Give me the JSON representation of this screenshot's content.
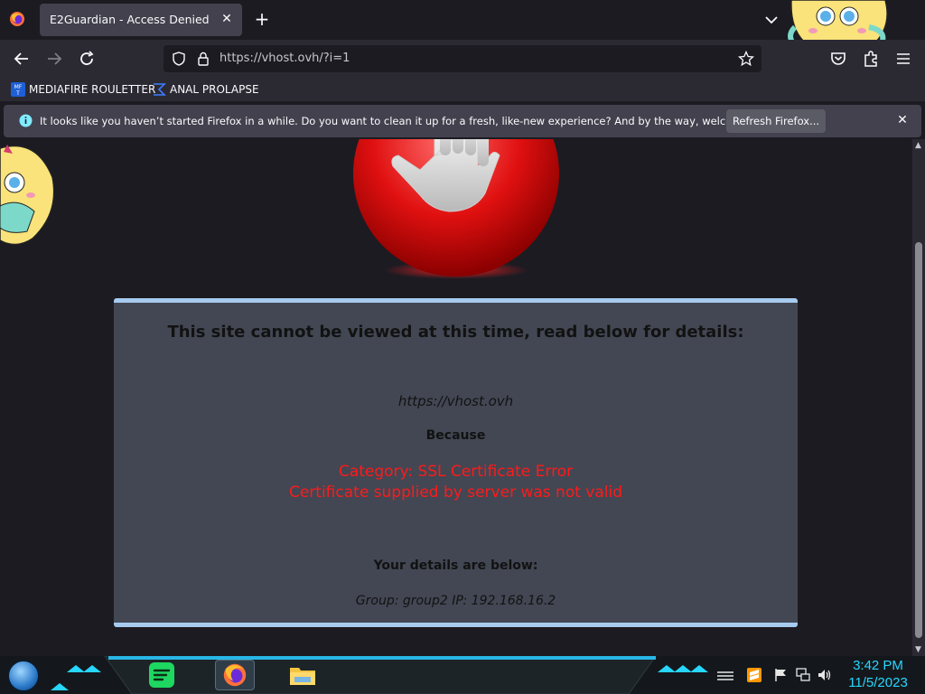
{
  "browser": {
    "tab": {
      "title": "E2Guardian - Access Denied"
    },
    "url": "https://vhost.ovh/?i=1",
    "bookmarks": [
      {
        "label": "MEDIAFIRE ROULETTER",
        "icon": "mediafire-icon"
      },
      {
        "label": "ANAL PROLAPSE",
        "icon": "sigma-icon"
      }
    ],
    "notification": {
      "text": "It looks like you haven’t started Firefox in a while. Do you want to clean it up for a fresh, like-new experience? And by the way, welcome back!",
      "button": "Refresh Firefox..."
    }
  },
  "page": {
    "title": "This site cannot be viewed at this time, read below for details:",
    "blocked_url": "https://vhost.ovh",
    "because": "Because",
    "category": "Category: SSL Certificate Error",
    "reason": "Certificate supplied by server was not valid",
    "details_heading": "Your details are below:",
    "details": "Group: group2   IP: 192.168.16.2"
  },
  "taskbar": {
    "time": "3:42 PM",
    "date": "11/5/2023",
    "apps": [
      "spotify-icon",
      "firefox-icon",
      "file-explorer-icon"
    ]
  },
  "colors": {
    "accent_red": "#ff1a1a",
    "panel_bg": "#424753",
    "panel_border": "#a6cbef",
    "clock": "#27d7ff"
  }
}
